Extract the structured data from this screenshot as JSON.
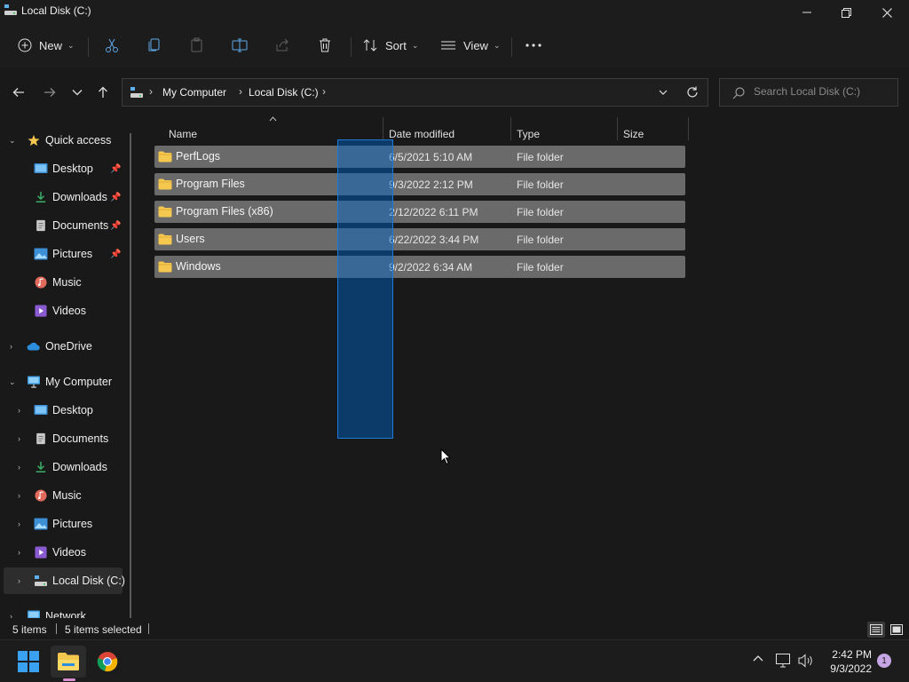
{
  "window": {
    "title": "Local Disk (C:)"
  },
  "commandbar": {
    "new_label": "New",
    "sort_label": "Sort",
    "view_label": "View"
  },
  "address": {
    "crumbs": [
      "My Computer",
      "Local Disk (C:)"
    ],
    "search_placeholder": "Search Local Disk (C:)"
  },
  "sidebar": {
    "quick_access": {
      "label": "Quick access",
      "items": [
        {
          "label": "Desktop",
          "icon": "desktop-icon",
          "pinned": true
        },
        {
          "label": "Downloads",
          "icon": "downloads-icon",
          "pinned": true
        },
        {
          "label": "Documents",
          "icon": "documents-icon",
          "pinned": true
        },
        {
          "label": "Pictures",
          "icon": "pictures-icon",
          "pinned": true
        },
        {
          "label": "Music",
          "icon": "music-icon",
          "pinned": false
        },
        {
          "label": "Videos",
          "icon": "videos-icon",
          "pinned": false
        }
      ]
    },
    "onedrive": {
      "label": "OneDrive"
    },
    "my_computer": {
      "label": "My Computer",
      "items": [
        {
          "label": "Desktop",
          "icon": "desktop-icon"
        },
        {
          "label": "Documents",
          "icon": "documents-icon"
        },
        {
          "label": "Downloads",
          "icon": "downloads-icon"
        },
        {
          "label": "Music",
          "icon": "music-icon"
        },
        {
          "label": "Pictures",
          "icon": "pictures-icon"
        },
        {
          "label": "Videos",
          "icon": "videos-icon"
        },
        {
          "label": "Local Disk (C:)",
          "icon": "drive-icon",
          "selected": true
        }
      ]
    },
    "network": {
      "label": "Network"
    }
  },
  "columns": {
    "name": "Name",
    "date_modified": "Date modified",
    "type": "Type",
    "size": "Size"
  },
  "files": [
    {
      "name": "PerfLogs",
      "date": "6/5/2021 5:10 AM",
      "type": "File folder",
      "selected": true
    },
    {
      "name": "Program Files",
      "date": "9/3/2022 2:12 PM",
      "type": "File folder",
      "selected": true
    },
    {
      "name": "Program Files (x86)",
      "date": "2/12/2022 6:11 PM",
      "type": "File folder",
      "selected": true
    },
    {
      "name": "Users",
      "date": "6/22/2022 3:44 PM",
      "type": "File folder",
      "selected": true
    },
    {
      "name": "Windows",
      "date": "9/2/2022 6:34 AM",
      "type": "File folder",
      "selected": true
    }
  ],
  "status": {
    "item_count": "5 items",
    "selected_count": "5 items selected"
  },
  "taskbar": {
    "time": "2:42 PM",
    "date": "9/3/2022",
    "notification_count": "1"
  },
  "colors": {
    "accent": "#0066cc",
    "row_selected": "#6a6a6a",
    "folder": "#f4c84f"
  }
}
